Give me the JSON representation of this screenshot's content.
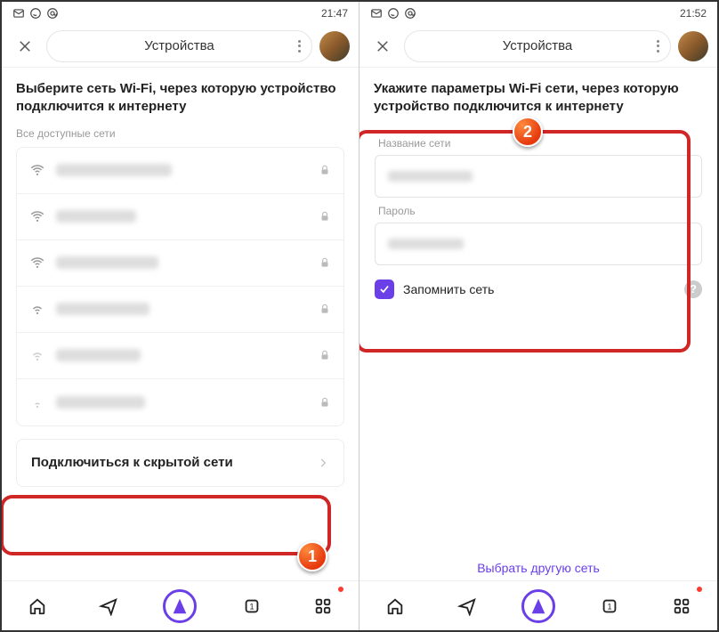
{
  "left": {
    "status_time": "21:47",
    "header_title": "Устройства",
    "heading": "Выберите сеть Wi-Fi, через которую устройство подключится к интернету",
    "all_networks_label": "Все доступные сети",
    "hidden_network_label": "Подключиться к скрытой сети",
    "badge": "1"
  },
  "right": {
    "status_time": "21:52",
    "header_title": "Устройства",
    "heading": "Укажите параметры Wi-Fi сети, через которую устройство подключится к интернету",
    "ssid_label": "Название сети",
    "password_label": "Пароль",
    "remember_label": "Запомнить сеть",
    "alt_network_link": "Выбрать другую сеть",
    "badge": "2"
  }
}
